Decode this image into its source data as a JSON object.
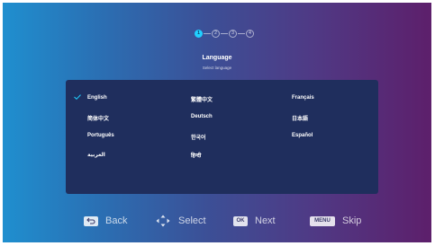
{
  "stepper": {
    "steps": [
      "1",
      "2",
      "3",
      "4"
    ],
    "active_index": 0
  },
  "header": {
    "title": "Language",
    "subtitle": "Select language"
  },
  "languages": [
    {
      "label": "English",
      "selected": true
    },
    {
      "label": "繁體中文",
      "selected": false
    },
    {
      "label": "Français",
      "selected": false
    },
    {
      "label": "简体中文",
      "selected": false
    },
    {
      "label": "Deutsch",
      "selected": false
    },
    {
      "label": "日本語",
      "selected": false
    },
    {
      "label": "Português",
      "selected": false
    },
    {
      "label": "한국어",
      "selected": false
    },
    {
      "label": "Español",
      "selected": false
    },
    {
      "label": "العربية",
      "selected": false
    },
    {
      "label": "हिन्दी",
      "selected": false
    }
  ],
  "footer": {
    "back_label": "Back",
    "select_label": "Select",
    "ok_badge": "OK",
    "next_label": "Next",
    "menu_badge": "MENU",
    "skip_label": "Skip"
  },
  "colors": {
    "accent": "#20d0ff",
    "panel": "#1f2e5d"
  }
}
